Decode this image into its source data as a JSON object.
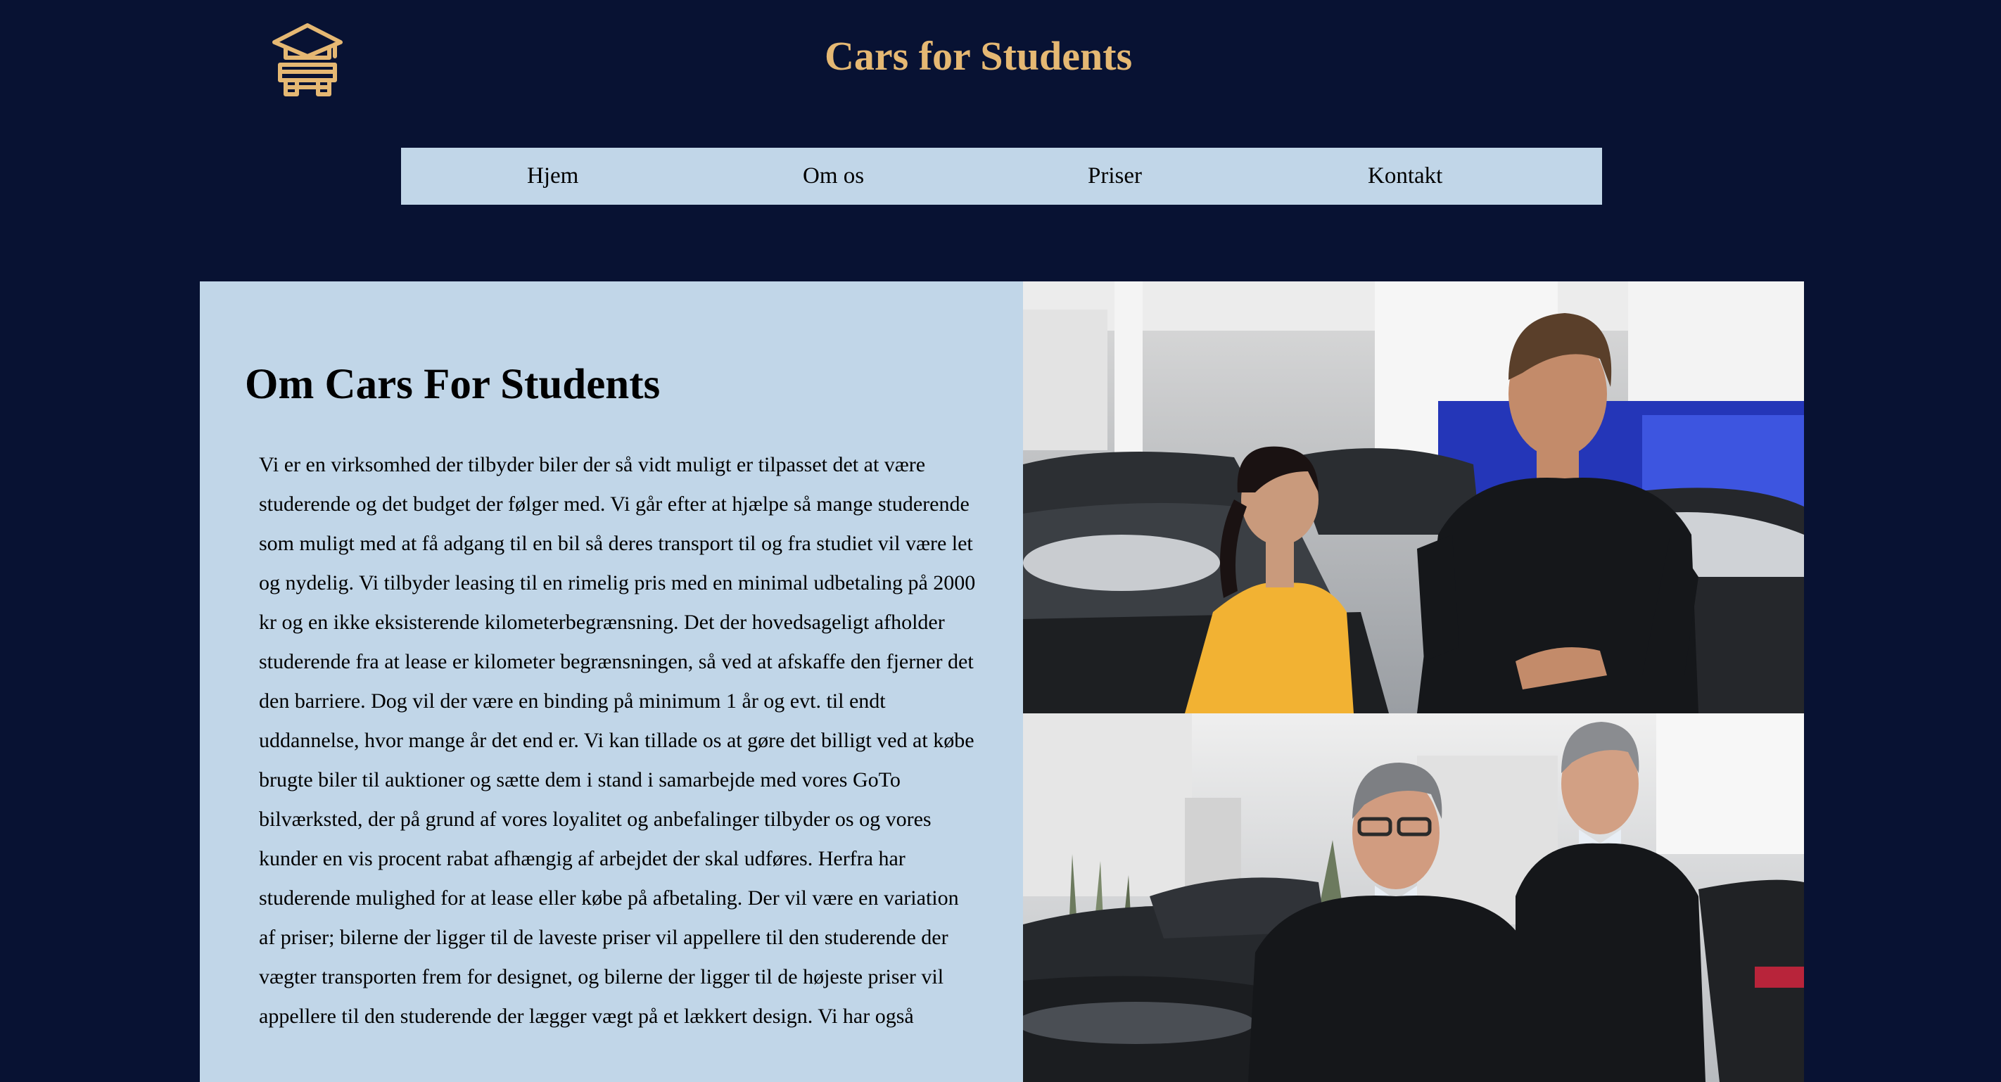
{
  "header": {
    "logo_icon": "graduation-cap-car-icon",
    "title": "Cars for Students"
  },
  "nav": {
    "items": [
      {
        "label": "Hjem"
      },
      {
        "label": "Om os"
      },
      {
        "label": "Priser"
      },
      {
        "label": "Kontakt"
      }
    ]
  },
  "about": {
    "heading": "Om Cars For Students",
    "body": "Vi er en virksomhed der tilbyder biler der så vidt muligt er tilpasset det at være studerende og det budget der følger med. Vi går efter at hjælpe så mange studerende som muligt med at få adgang til en bil så deres transport til og fra studiet vil være let og nydelig. Vi tilbyder leasing til en rimelig pris med en minimal udbetaling på 2000 kr og en ikke eksisterende kilometerbegrænsning. Det der hovedsageligt afholder studerende fra at lease er kilometer begrænsningen, så ved at afskaffe den fjerner det den barriere. Dog vil der være en binding på minimum 1 år og evt. til endt uddannelse, hvor mange år det end er. Vi kan tillade os at gøre det billigt ved at købe brugte biler til auktioner og sætte dem i stand i samarbejde med vores GoTo bilværksted, der på grund af vores loyalitet og anbefalinger tilbyder os og vores kunder en vis procent rabat afhængig af arbejdet der skal udføres. Herfra har studerende mulighed for at lease eller købe på afbetaling. Der vil være en variation af priser; bilerne der ligger til de laveste priser vil appellere til den studerende der vægter transporten frem for designet, og bilerne der ligger til de højeste priser vil appellere til den studerende der lægger vægt på et lækkert design. Vi har også"
  },
  "photos": [
    {
      "subject": "salesman-with-student-photo"
    },
    {
      "subject": "two-dealers-photo"
    }
  ],
  "colors": {
    "background": "#081233",
    "accent": "#e5b873",
    "panel": "#c1d6e8"
  }
}
